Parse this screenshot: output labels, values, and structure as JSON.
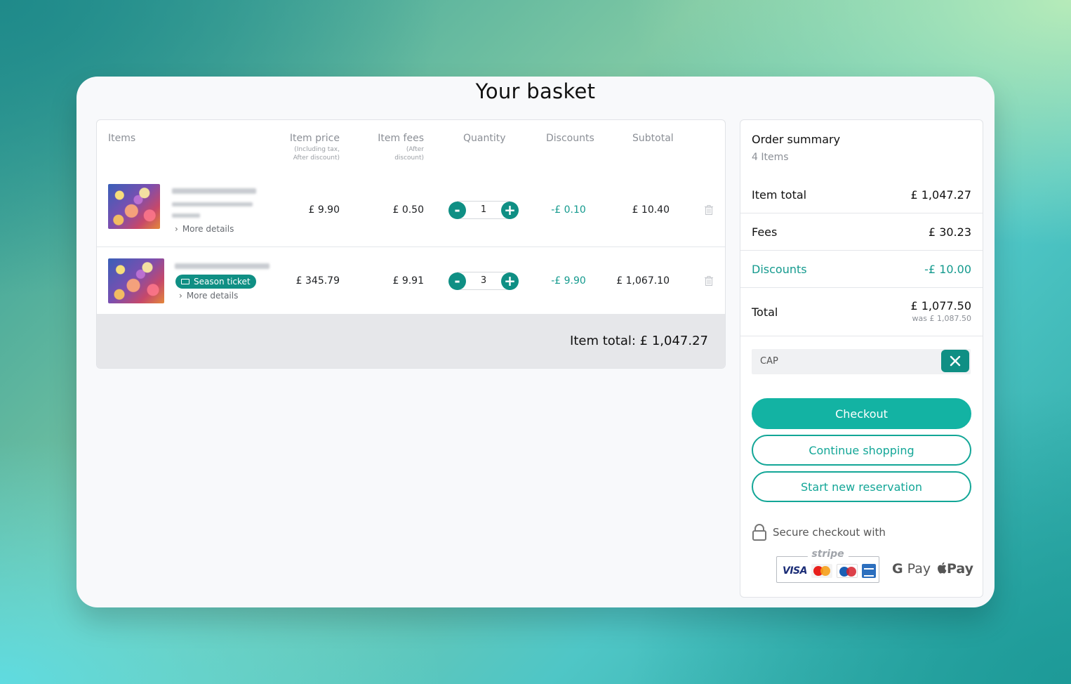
{
  "page": {
    "title": "Your basket"
  },
  "table": {
    "headers": {
      "items": "Items",
      "item_price": "Item price",
      "item_price_sub": "(Including tax, After discount)",
      "item_fees": "Item fees",
      "item_fees_sub": "(After discount)",
      "quantity": "Quantity",
      "discounts": "Discounts",
      "subtotal": "Subtotal"
    },
    "rows": [
      {
        "more_details": "More details",
        "price": "£ 9.90",
        "fees": "£ 0.50",
        "quantity": "1",
        "discount": "-£ 0.10",
        "subtotal": "£ 10.40"
      },
      {
        "badge": "Season ticket",
        "more_details": "More details",
        "price": "£ 345.79",
        "fees": "£ 9.91",
        "quantity": "3",
        "discount": "-£ 9.90",
        "subtotal": "£ 1,067.10"
      }
    ],
    "stepper": {
      "minus": "-",
      "plus": "+"
    },
    "footer_total": "Item total: £ 1,047.27"
  },
  "summary": {
    "title": "Order summary",
    "count": "4 Items",
    "item_total_label": "Item total",
    "item_total_value": "£ 1,047.27",
    "fees_label": "Fees",
    "fees_value": "£ 30.23",
    "discounts_label": "Discounts",
    "discounts_value": "-£ 10.00",
    "total_label": "Total",
    "total_value": "£ 1,077.50",
    "total_was": "was £ 1,087.50",
    "coupon_code": "CAP",
    "checkout_label": "Checkout",
    "continue_label": "Continue shopping",
    "new_reservation_label": "Start new reservation",
    "secure_text": "Secure checkout with",
    "stripe_label": "stripe",
    "visa_label": "VISA",
    "gpay_label": "Pay",
    "applepay_label": "Pay"
  },
  "colors": {
    "accent": "#0f8f84",
    "primary_button": "#13b3a3",
    "discount_text": "#149a8e"
  },
  "icons": {
    "remove": "trash-icon",
    "clear_coupon": "close-icon",
    "secure": "lock-icon",
    "season_ticket": "ticket-icon",
    "more_details": "chevron-right-icon"
  }
}
